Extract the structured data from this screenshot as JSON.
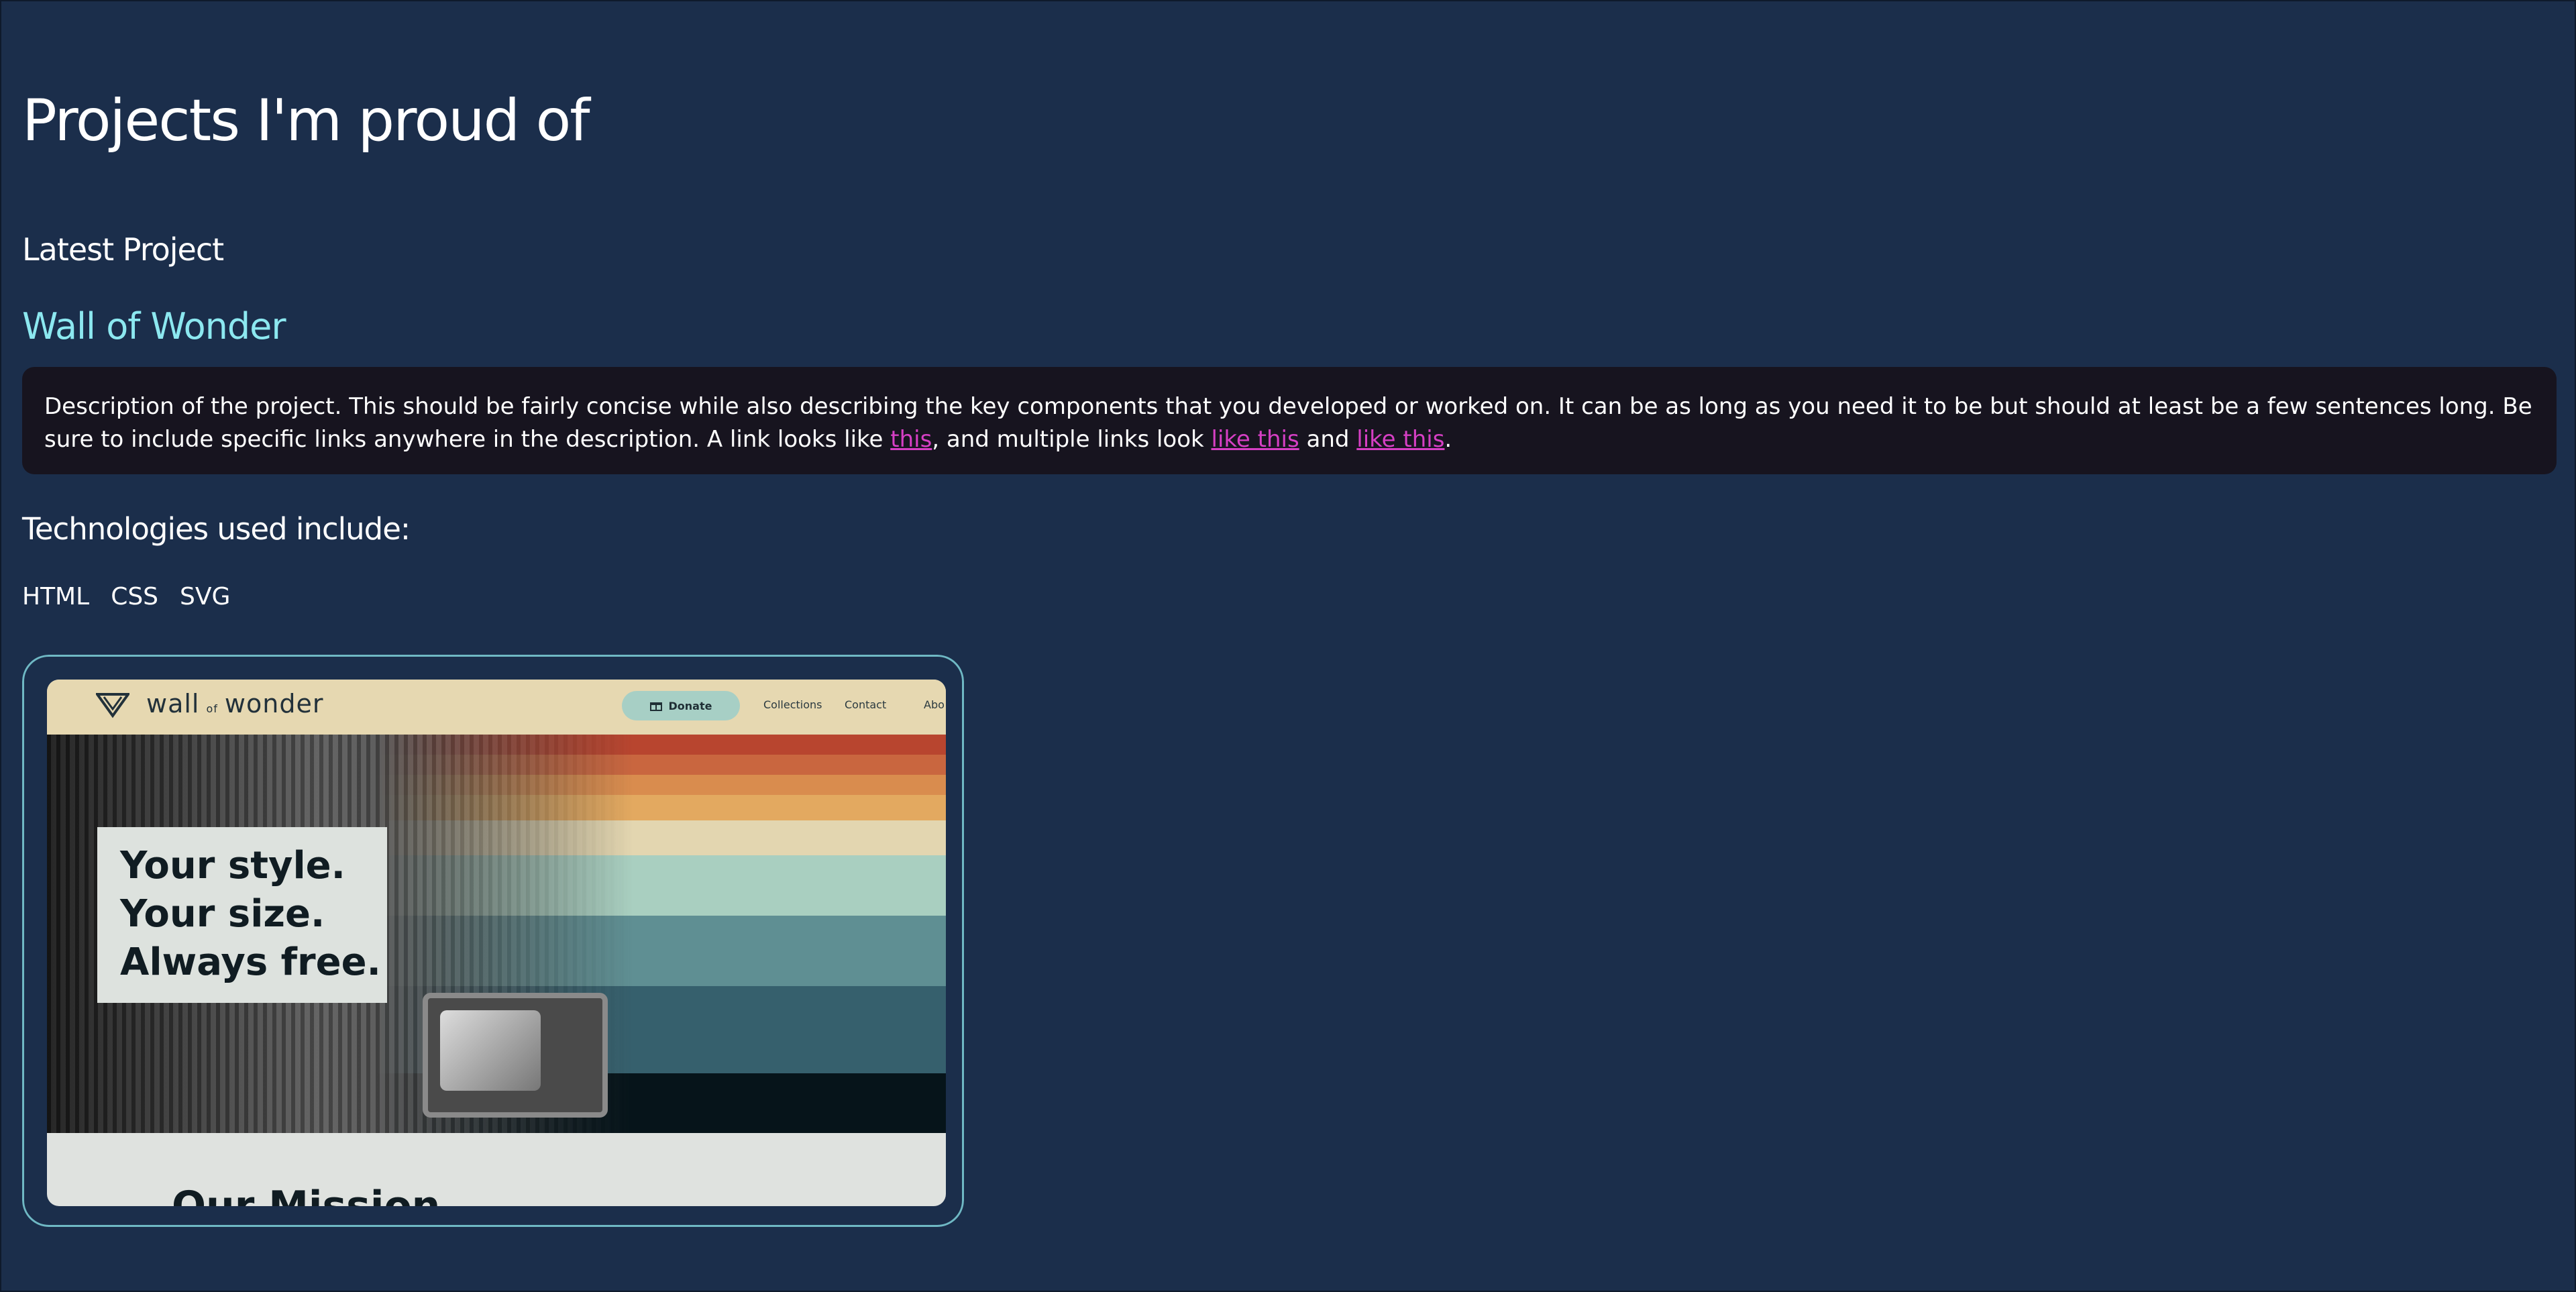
{
  "page": {
    "title": "Projects I'm proud of"
  },
  "project": {
    "section_label": "Latest Project",
    "name": "Wall of Wonder",
    "description": {
      "part1": "Description of the project. This should be fairly concise while also describing the key components that you developed or worked on. It can be as long as you need it to be but should at least be a few sentences long. Be sure to include specific links anywhere in the description. A link looks like ",
      "link1": "this",
      "part2": ", and multiple links look ",
      "link2": "like this",
      "part3": " and ",
      "link3": "like this",
      "part4": "."
    },
    "technologies_heading": "Technologies used include:",
    "technologies": [
      "HTML",
      "CSS",
      "SVG"
    ]
  },
  "screenshot": {
    "brand_left": "wall",
    "brand_of": "of",
    "brand_right": "wonder",
    "donate_label": "Donate",
    "nav_collections": "Collections",
    "nav_contact": "Contact",
    "nav_about": "Abo",
    "tagline": [
      "Your style.",
      "Your size.",
      "Always free."
    ],
    "mission": "Our Mission"
  },
  "colors": {
    "background": "#1b2e4b",
    "accent": "#8ce8f0",
    "link": "#d63fc4",
    "description_bg": "#17141f"
  }
}
